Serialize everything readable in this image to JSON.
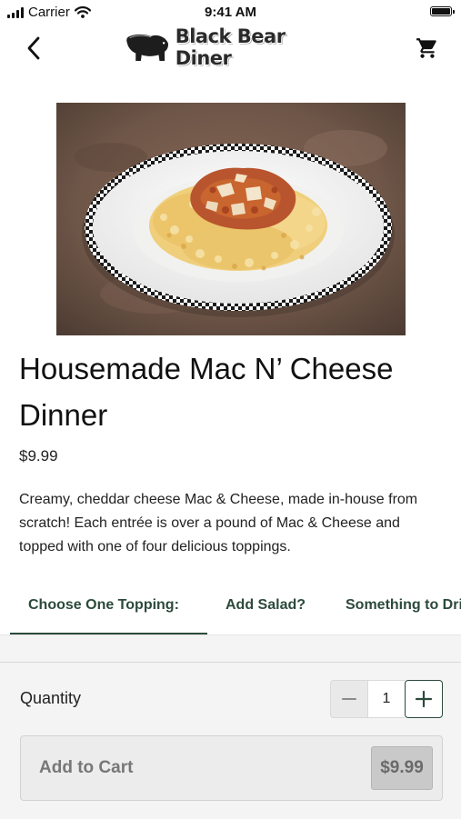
{
  "status_bar": {
    "carrier": "Carrier",
    "time": "9:41 AM"
  },
  "nav": {
    "back_icon": "chevron-left-icon",
    "logo_text": "Black Bear Diner",
    "cart_icon": "shopping-cart-icon"
  },
  "item": {
    "title": "Housemade Mac N’ Cheese Dinner",
    "price": "$9.99",
    "description": "Creamy, cheddar cheese Mac & Cheese, made in-house from scratch! Each entrée is over a pound of Mac & Cheese and topped with one of four delicious toppings."
  },
  "tabs": [
    {
      "label": "Choose One Topping:",
      "active": true
    },
    {
      "label": "Add Salad?",
      "active": false
    },
    {
      "label": "Something to Drink?",
      "active": false
    }
  ],
  "quantity": {
    "label": "Quantity",
    "value": "1"
  },
  "cart_button": {
    "label": "Add to Cart",
    "price": "$9.99"
  },
  "colors": {
    "accent": "#2c4a3b",
    "panel_bg": "#f4f4f4",
    "button_bg": "#ececec"
  }
}
